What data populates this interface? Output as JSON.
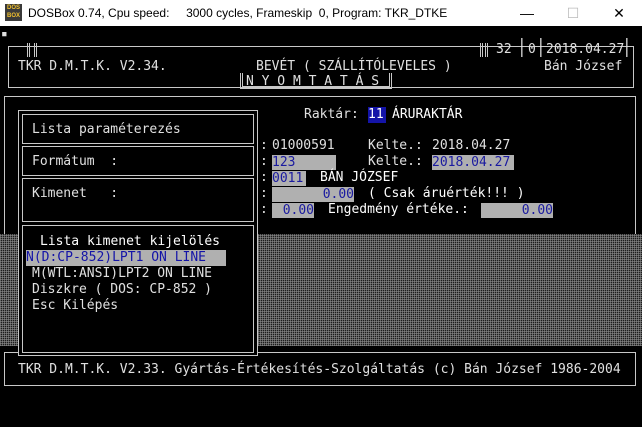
{
  "window": {
    "title": "DOSBox 0.74, Cpu speed:     3000 cycles, Frameskip  0, Program: TKR_DTKE",
    "icon_text": "DOS BOX",
    "min_glyph": "—",
    "max_glyph": "☐",
    "close_glyph": "✕"
  },
  "header": {
    "corner_glyph": "▪",
    "program": "TKR D.M.T.K. V2.34.",
    "doc_title": "BEVÉT ( SZÁLLÍTÓLEVELES )",
    "user": "Bán József",
    "mode": "N Y O M T A T Á S",
    "counter1": "32",
    "counter2": "0",
    "date": "2018.04.27"
  },
  "form": {
    "raktar_label": "Raktár:",
    "raktar_code": "11",
    "raktar_name": "ÁRURAKTÁR",
    "doc_number": "01000591",
    "kelte1_label": "Kelte.:",
    "kelte1_value": "2018.04.27",
    "code_field": "123",
    "kelte2_label": "Kelte.:",
    "kelte2_value": "2018.04.27",
    "partner_code": "0011",
    "partner_name": "BÁN JÓZSEF",
    "amount1": "0.00",
    "csak_text": "( Csak áruérték!!! )",
    "amount2": "0.00",
    "engedmeny_label": "Engedmény értéke.:",
    "engedmeny_value": "0.00",
    "colon": ":"
  },
  "panel": {
    "params": "Lista paraméterezés",
    "format_label": "Formátum  :",
    "kimenet_label": "Kimenet   :",
    "list_title": "Lista kimenet kijelölés",
    "options": [
      "N(D:CP-852)LPT1 ON LINE",
      "M(WTL:ANSI)LPT2 ON LINE",
      "Diszkre ( DOS: CP-852 )",
      "Esc Kilépés"
    ]
  },
  "footer": {
    "text": "TKR D.M.T.K. V2.33. Gyártás-Értékesítés-Szolgáltatás (c) Bán József 1986-2004"
  }
}
